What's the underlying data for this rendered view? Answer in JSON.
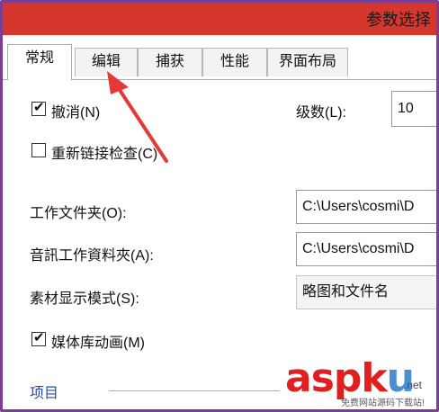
{
  "window": {
    "title": "参数选择",
    "accent": "#d6372c",
    "frame_color": "#7b3e95"
  },
  "tabs": [
    {
      "label": "常规",
      "active": true
    },
    {
      "label": "编辑",
      "active": false
    },
    {
      "label": "捕获",
      "active": false
    },
    {
      "label": "性能",
      "active": false
    },
    {
      "label": "界面布局",
      "active": false
    }
  ],
  "general": {
    "undo": {
      "label": "撤消(N)",
      "checked": true
    },
    "levels": {
      "label": "级数(L):",
      "value": "10"
    },
    "relink": {
      "label": "重新链接检查(C)",
      "checked": false
    },
    "working_folder": {
      "label": "工作文件夹(O):",
      "value": "C:\\Users\\cosmi\\D"
    },
    "audio_folder": {
      "label": "音訊工作資料夾(A):",
      "value": "C:\\Users\\cosmi\\D"
    },
    "thumb_mode": {
      "label": "素材显示模式(S):",
      "value": "略图和文件名"
    },
    "library_anim": {
      "label": "媒体库动画(M)",
      "checked": true
    },
    "section_items": {
      "label": "项目"
    }
  },
  "watermark": {
    "brand_a": "asp",
    "brand_k": "k",
    "brand_u": "u",
    "net": ".net",
    "sub": "免费网站源码下载站!"
  }
}
